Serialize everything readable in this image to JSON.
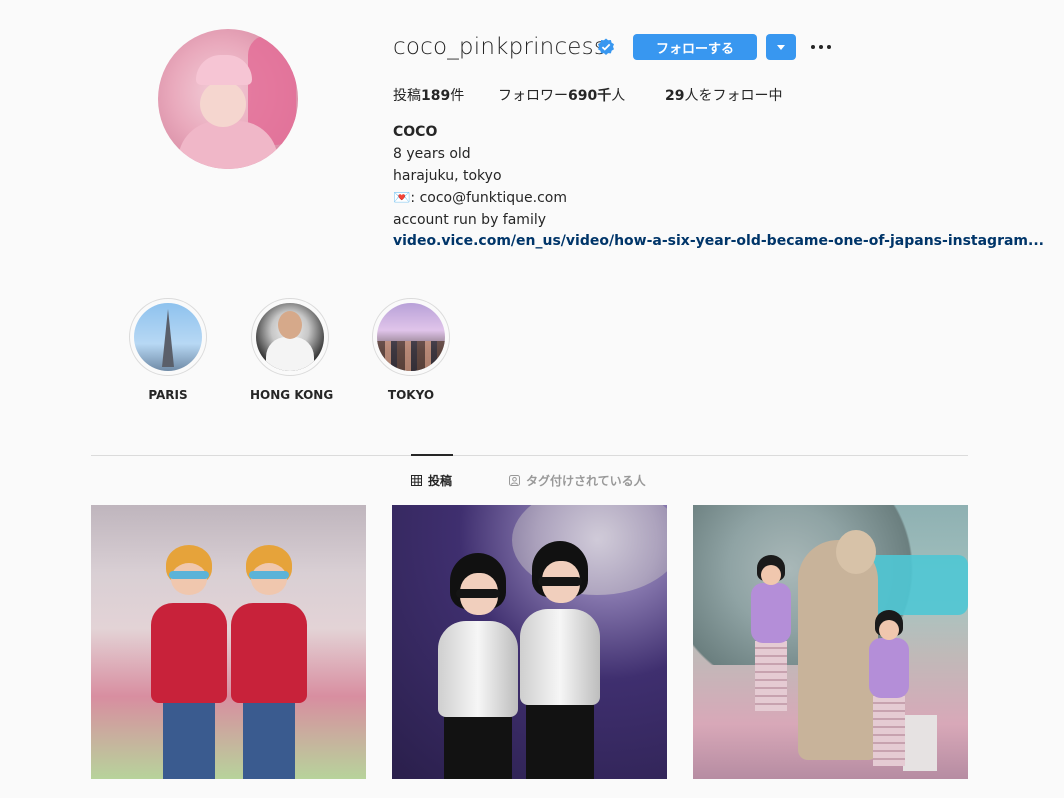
{
  "profile": {
    "username": "coco_pinkprincess",
    "follow_label": "フォローする",
    "stats": {
      "posts_prefix": "投稿",
      "posts_count": "189",
      "posts_suffix": "件",
      "followers_prefix": "フォロワー",
      "followers_count": "690千",
      "followers_suffix": "人",
      "following_count": "29",
      "following_suffix": "人をフォロー中"
    },
    "bio": {
      "name": "COCO",
      "lines": [
        "8 years old",
        "harajuku, tokyo",
        "💌: coco@funktique.com",
        "account run by family"
      ],
      "link": "video.vice.com/en_us/video/how-a-six-year-old-became-one-of-japans-instagram..."
    }
  },
  "highlights": [
    {
      "label": "PARIS"
    },
    {
      "label": "HONG KONG"
    },
    {
      "label": "TOKYO"
    }
  ],
  "tabs": [
    {
      "icon": "grid-icon",
      "label": "投稿",
      "active": true
    },
    {
      "icon": "tagged-icon",
      "label": "タグ付けされている人",
      "active": false
    }
  ],
  "colors": {
    "primary_button": "#3897f0",
    "link": "#003569",
    "text": "#262626",
    "muted": "#999999",
    "background": "#fafafa"
  },
  "posts": [
    {
      "icon": "post-1-image"
    },
    {
      "icon": "post-2-image"
    },
    {
      "icon": "post-3-image"
    }
  ]
}
